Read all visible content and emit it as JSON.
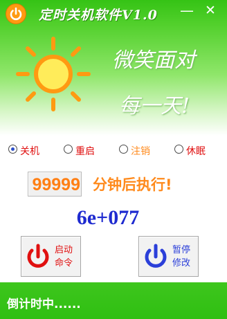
{
  "window": {
    "title": "定时关机软件V1.0",
    "minimize_glyph": "—",
    "close_glyph": "✕",
    "logo_icon": "power-icon"
  },
  "banner": {
    "slogan_line1": "微笑面对",
    "slogan_line2": "每一天!",
    "sun_icon": "sun-icon"
  },
  "actions": {
    "options": [
      {
        "label": "关机",
        "selected": true,
        "color": "#e01010"
      },
      {
        "label": "重启",
        "selected": false,
        "color": "#e01010"
      },
      {
        "label": "注销",
        "selected": false,
        "color": "#ff8a1c"
      },
      {
        "label": "休眠",
        "selected": false,
        "color": "#e01010"
      }
    ]
  },
  "timer": {
    "minutes_value": "99999",
    "minutes_suffix": "分钟后执行!",
    "countdown_value": "6e+077"
  },
  "buttons": {
    "start": {
      "line1": "启动",
      "line2": "命令",
      "icon": "power-icon",
      "color": "#e01010"
    },
    "pause": {
      "line1": "暂停",
      "line2": "修改",
      "icon": "power-icon",
      "color": "#2b3fd9"
    }
  },
  "status": {
    "text": "倒计时中......"
  },
  "colors": {
    "accent_green": "#3ec61d",
    "orange": "#ff8a1c",
    "blue": "#1f2bd0",
    "red": "#e01010"
  }
}
